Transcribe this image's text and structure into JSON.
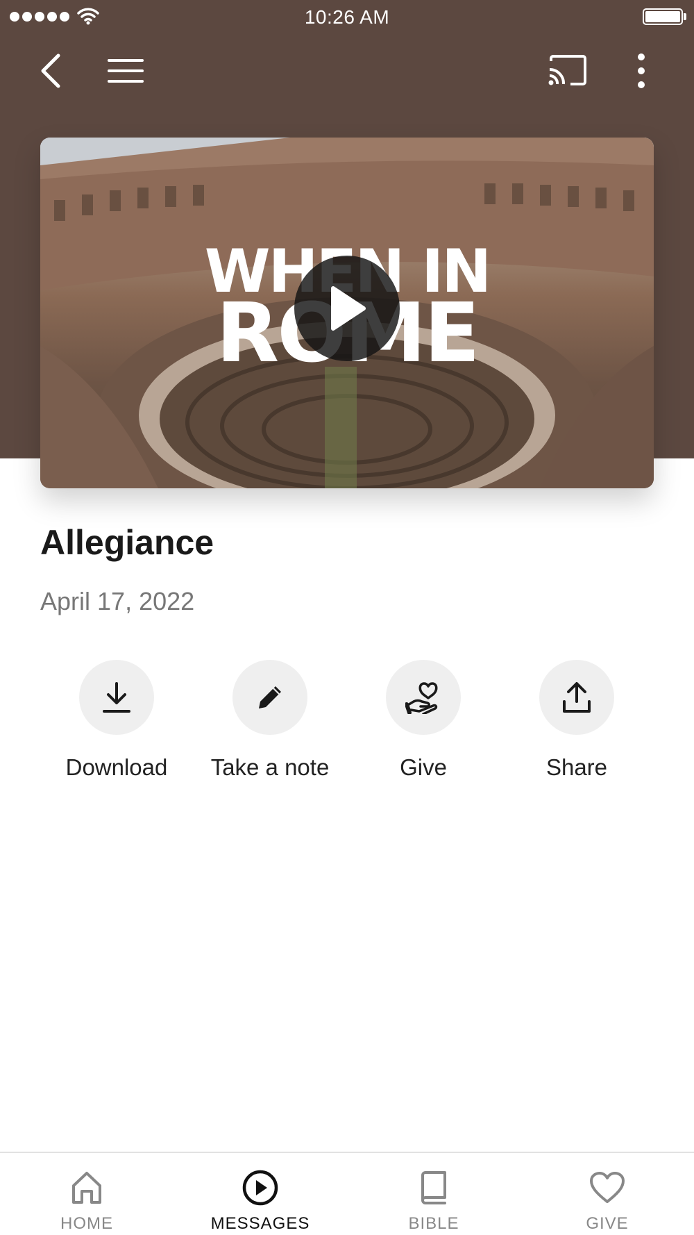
{
  "status_bar": {
    "time": "10:26 AM"
  },
  "toolbar": {
    "back_icon": "chevron-left-icon",
    "menu_icon": "hamburger-menu-icon",
    "cast_icon": "cast-icon",
    "more_icon": "more-vertical-icon"
  },
  "hero": {
    "title_line1": "WHEN IN",
    "title_line2": "ROME",
    "play_icon": "play-icon"
  },
  "message": {
    "title": "Allegiance",
    "date": "April 17, 2022"
  },
  "actions": [
    {
      "label": "Download",
      "icon": "download-icon"
    },
    {
      "label": "Take a note",
      "icon": "pencil-icon"
    },
    {
      "label": "Give",
      "icon": "hand-heart-icon"
    },
    {
      "label": "Share",
      "icon": "share-icon"
    }
  ],
  "tabs": [
    {
      "label": "HOME",
      "icon": "home-icon",
      "active": false
    },
    {
      "label": "MESSAGES",
      "icon": "play-circle-icon",
      "active": true
    },
    {
      "label": "BIBLE",
      "icon": "book-icon",
      "active": false
    },
    {
      "label": "GIVE",
      "icon": "heart-icon",
      "active": false
    }
  ],
  "colors": {
    "header_background": "#5c4840",
    "active_tab": "#111111",
    "inactive_tab": "#888888",
    "action_circle": "#efefef"
  }
}
